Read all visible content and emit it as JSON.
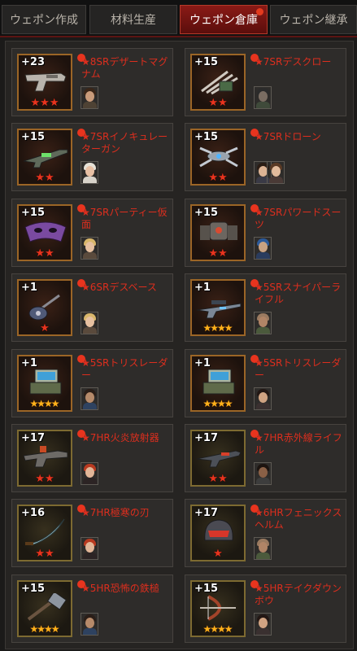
{
  "tabs": [
    {
      "label": "ウェポン作成",
      "active": false
    },
    {
      "label": "材料生産",
      "active": false
    },
    {
      "label": "ウェポン倉庫",
      "active": true
    },
    {
      "label": "ウェポン継承",
      "active": false
    }
  ],
  "weapons": [
    {
      "level": "+23",
      "name": "★8SRデザートマグナム",
      "stars": 3,
      "star_color": "red",
      "weapon_icon": "pistol-icon",
      "owner": "male-brown-hair"
    },
    {
      "level": "+15",
      "name": "★7SRデスクロー",
      "stars": 2,
      "star_color": "red",
      "weapon_icon": "claw-icon",
      "owner": "masked-soldier"
    },
    {
      "level": "+15",
      "name": "★7SRイノキュレーターガン",
      "stars": 2,
      "star_color": "red",
      "weapon_icon": "rifle-icon",
      "owner": "female-nurse"
    },
    {
      "level": "+15",
      "name": "★7SRドローン",
      "stars": 2,
      "star_color": "red",
      "weapon_icon": "drone-icon",
      "owner": "female-pair"
    },
    {
      "level": "+15",
      "name": "★7SRパーティー仮面",
      "stars": 2,
      "star_color": "red",
      "weapon_icon": "mask-icon",
      "owner": "female-blonde"
    },
    {
      "level": "+15",
      "name": "★7SRパワードスーツ",
      "stars": 2,
      "star_color": "red",
      "weapon_icon": "suit-icon",
      "owner": "blue-hood"
    },
    {
      "level": "+1",
      "name": "★6SRデスベース",
      "stars": 1,
      "star_color": "red",
      "weapon_icon": "bass-guitar-icon",
      "owner": "female-blonde"
    },
    {
      "level": "+1",
      "name": "★5SRスナイパーライフル",
      "stars": 4,
      "star_color": "gold",
      "weapon_icon": "sniper-rifle-icon",
      "owner": "male-bald"
    },
    {
      "level": "+1",
      "name": "★5SRトリスレーダー",
      "stars": 4,
      "star_color": "gold",
      "weapon_icon": "radar-icon",
      "owner": "male-soldier"
    },
    {
      "level": "+1",
      "name": "★5SRトリスレーダー",
      "stars": 4,
      "star_color": "gold",
      "weapon_icon": "radar-icon",
      "owner": "female-dark"
    },
    {
      "level": "+17",
      "name": "★7HR火炎放射器",
      "stars": 2,
      "star_color": "red",
      "weapon_icon": "flamethrower-icon",
      "owner": "female-red-hair"
    },
    {
      "level": "+17",
      "name": "★7HR赤外線ライフル",
      "stars": 2,
      "star_color": "red",
      "weapon_icon": "infrared-rifle-icon",
      "owner": "male-dark"
    },
    {
      "level": "+16",
      "name": "★7HR極寒の刃",
      "stars": 2,
      "star_color": "red",
      "weapon_icon": "blade-icon",
      "owner": "female-red-hair"
    },
    {
      "level": "+17",
      "name": "★6HRフェニックスヘルム",
      "stars": 1,
      "star_color": "red",
      "weapon_icon": "helmet-icon",
      "owner": "male-bald"
    },
    {
      "level": "+15",
      "name": "★5HR恐怖の鉄槌",
      "stars": 4,
      "star_color": "gold",
      "weapon_icon": "hammer-icon",
      "owner": "male-soldier"
    },
    {
      "level": "+15",
      "name": "★5HRテイクダウンボウ",
      "stars": 4,
      "star_color": "gold",
      "weapon_icon": "bow-icon",
      "owner": "female-dark"
    }
  ]
}
